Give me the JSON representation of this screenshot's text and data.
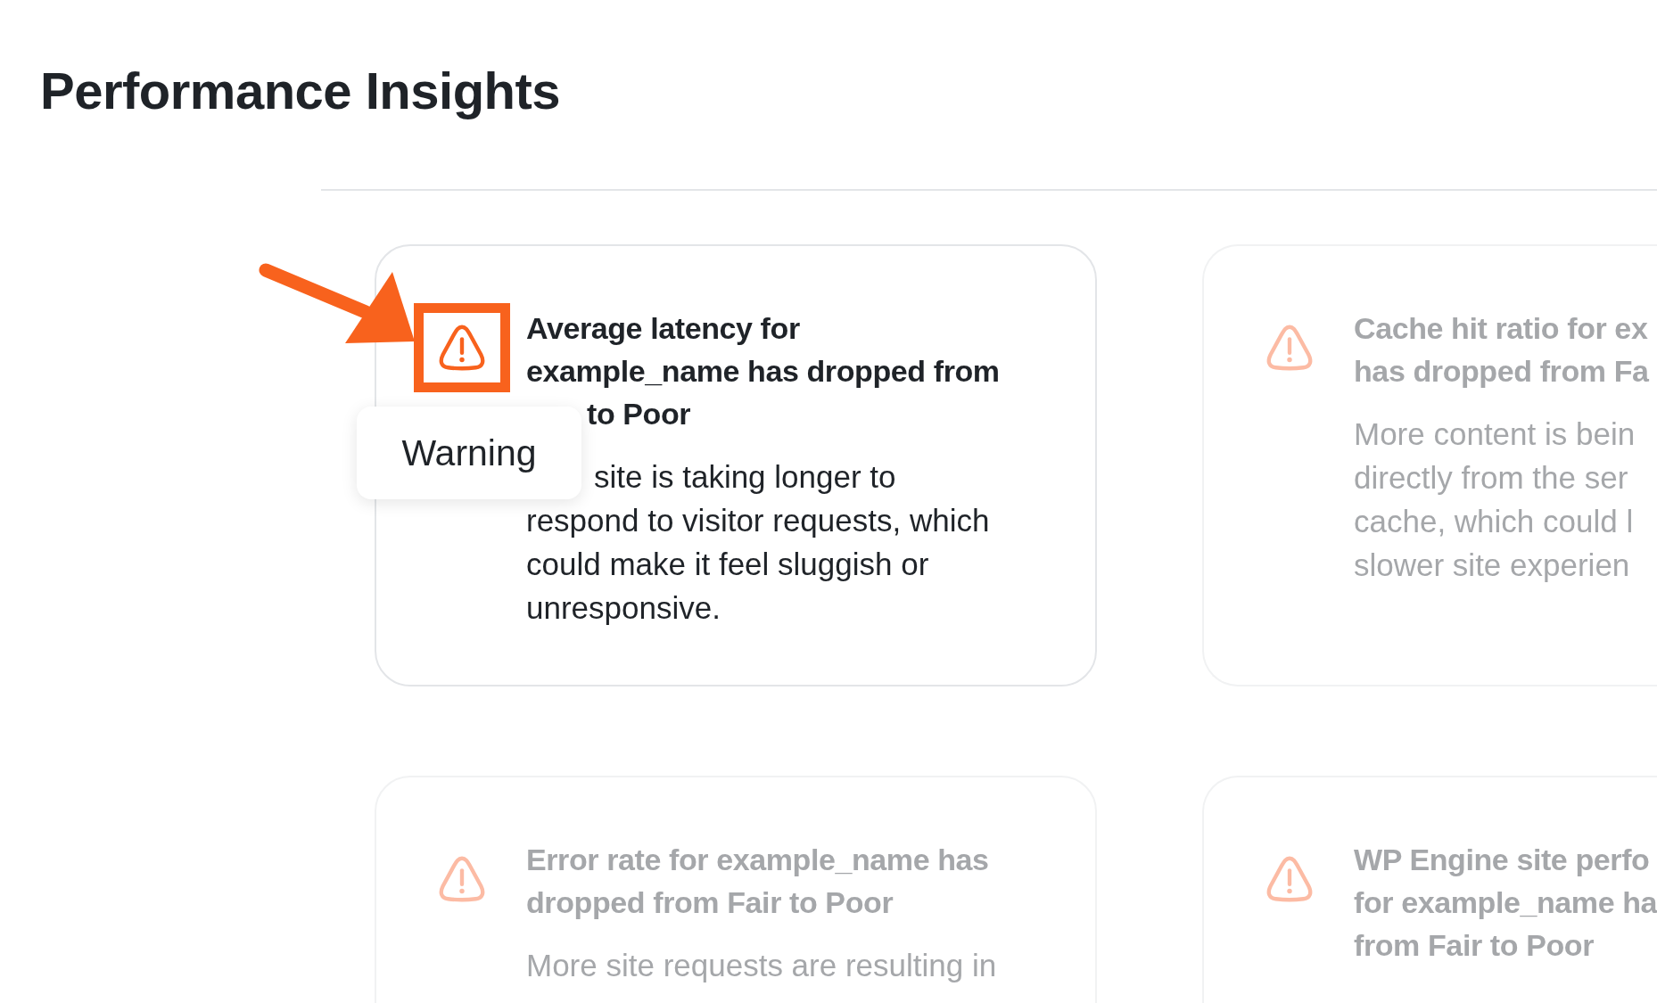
{
  "page": {
    "title": "Performance Insights"
  },
  "cards": [
    {
      "dimmed": false,
      "icon_highlighted": true,
      "tooltip": "Warning",
      "title_lines": [
        {
          "text": "Average latency for"
        },
        {
          "text": "example_name has dropped from"
        },
        {
          "text": "to Poor",
          "partly_hidden": true
        }
      ],
      "body_lines": [
        {
          "text": "site is taking longer to",
          "partly_hidden": true
        },
        {
          "text": "respond to visitor requests, which"
        },
        {
          "text": "could make it feel sluggish or"
        },
        {
          "text": "unresponsive."
        }
      ]
    },
    {
      "dimmed": true,
      "icon_highlighted": false,
      "title_lines": [
        {
          "text": "Cache hit ratio for ex"
        },
        {
          "text": "has dropped from Fa"
        }
      ],
      "body_lines": [
        {
          "text": "More content is bein"
        },
        {
          "text": "directly from the ser"
        },
        {
          "text": "cache, which could l"
        },
        {
          "text": "slower site experien"
        }
      ]
    },
    {
      "dimmed": true,
      "icon_highlighted": false,
      "title_lines": [
        {
          "text": "Error rate for example_name has"
        },
        {
          "text": "dropped from Fair to Poor"
        }
      ],
      "body_lines": [
        {
          "text": "More site requests are resulting in"
        }
      ]
    },
    {
      "dimmed": true,
      "icon_highlighted": false,
      "title_lines": [
        {
          "text": "WP Engine site perfo"
        },
        {
          "text": "for example_name ha"
        },
        {
          "text": "from Fair to Poor"
        }
      ]
    }
  ]
}
